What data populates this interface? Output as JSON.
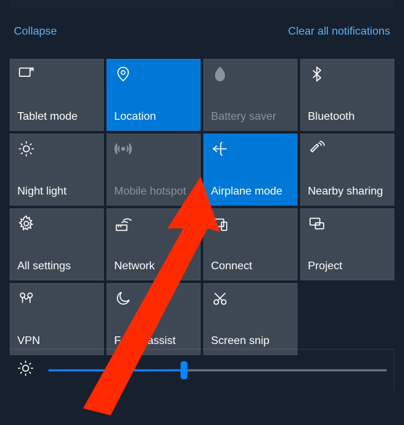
{
  "header": {
    "collapse": "Collapse",
    "clear": "Clear all notifications"
  },
  "tiles": [
    {
      "id": "tablet-mode",
      "label": "Tablet mode",
      "active": false,
      "dim": false
    },
    {
      "id": "location",
      "label": "Location",
      "active": true,
      "dim": false
    },
    {
      "id": "battery-saver",
      "label": "Battery saver",
      "active": false,
      "dim": true
    },
    {
      "id": "bluetooth",
      "label": "Bluetooth",
      "active": false,
      "dim": false
    },
    {
      "id": "night-light",
      "label": "Night light",
      "active": false,
      "dim": false
    },
    {
      "id": "mobile-hotspot",
      "label": "Mobile hotspot",
      "active": false,
      "dim": true
    },
    {
      "id": "airplane-mode",
      "label": "Airplane mode",
      "active": true,
      "dim": false
    },
    {
      "id": "nearby-sharing",
      "label": "Nearby sharing",
      "active": false,
      "dim": false
    },
    {
      "id": "all-settings",
      "label": "All settings",
      "active": false,
      "dim": false
    },
    {
      "id": "network",
      "label": "Network",
      "active": false,
      "dim": false
    },
    {
      "id": "connect",
      "label": "Connect",
      "active": false,
      "dim": false
    },
    {
      "id": "project",
      "label": "Project",
      "active": false,
      "dim": false
    },
    {
      "id": "vpn",
      "label": "VPN",
      "active": false,
      "dim": false
    },
    {
      "id": "focus-assist",
      "label": "Focus assist",
      "active": false,
      "dim": false
    },
    {
      "id": "screen-snip",
      "label": "Screen snip",
      "active": false,
      "dim": false
    }
  ],
  "brightness": {
    "value": 40
  },
  "annotation": {
    "arrow_target": "airplane-mode"
  }
}
